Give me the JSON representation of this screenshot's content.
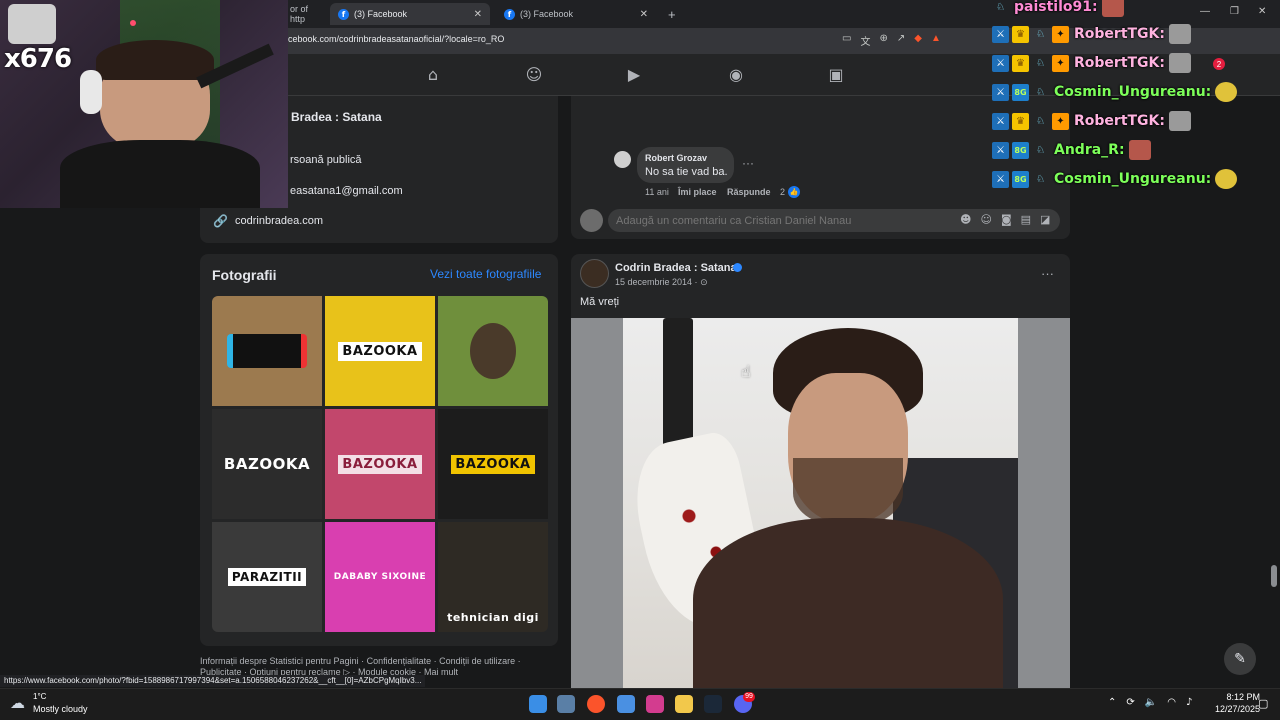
{
  "browser": {
    "tabs": [
      {
        "label": "or of http",
        "active": false
      },
      {
        "label": "(3) Facebook",
        "active": true
      },
      {
        "label": "(3) Facebook",
        "active": false
      }
    ],
    "url": "cebook.com/codrinbradeasatanaoficial/?locale=ro_RO",
    "status_url": "https://www.facebook.com/photo/?fbid=1588986717997394&set=a.1506588046237262&__cft__[0]=AZbCPgMqIbv3..."
  },
  "fb_nav": {
    "icons": [
      "home-icon",
      "friends-icon",
      "video-icon",
      "groups-icon",
      "gaming-icon"
    ],
    "notification_count": "2"
  },
  "intro": {
    "name": "Bradea : Satana",
    "category": "rsoană publică",
    "email": "easatana1@gmail.com",
    "website": "codrinbradea.com"
  },
  "photos": {
    "title": "Fotografii",
    "see_all": "Vezi toate fotografiile",
    "items": [
      {
        "label": "",
        "bg": "#9c7a4f"
      },
      {
        "label": "BAZOOKA",
        "bg": "#e8c21a"
      },
      {
        "label": "",
        "bg": "#6f8f3c"
      },
      {
        "label": "BAZOOKA",
        "bg": "#2c2c2c"
      },
      {
        "label": "BAZOOKA",
        "bg": "#c2476c"
      },
      {
        "label": "BAZOOKA",
        "bg": "#1c1c1c"
      },
      {
        "label": "PARAZITII",
        "bg": "#3a3a3a"
      },
      {
        "label": "DABABY SIXOINE",
        "bg": "#d93fb0"
      },
      {
        "label": "tehnician digi",
        "bg": "#2e2a24"
      }
    ]
  },
  "footer": {
    "line1": "Informații despre Statistici pentru Pagini · Confidențialitate · Condiții de utilizare ·",
    "line2": "Publicitate · Opțiuni pentru reclame ▷ · Module cookie · Mai mult"
  },
  "comment": {
    "author": "Robert Grozav",
    "text": "No sa tie vad ba.",
    "time": "11 ani",
    "like_action": "Îmi place",
    "reply_action": "Răspunde",
    "like_count": "2",
    "input_placeholder": "Adaugă un comentariu ca Cristian Daniel Nanau"
  },
  "post": {
    "author": "Codrin Bradea : Satana",
    "date": "15 decembrie 2014 · ",
    "text": "Mă vreți"
  },
  "stream": {
    "counter": "x676",
    "chat": [
      {
        "user": "paistilo91:",
        "color": "#ff8bd4"
      },
      {
        "user": "RobertTGK:",
        "color": "#ffb3e0"
      },
      {
        "user": "RobertTGK:",
        "color": "#ffb3e0"
      },
      {
        "user": "Cosmin_Ungureanu:",
        "color": "#7dff5a"
      },
      {
        "user": "RobertTGK:",
        "color": "#ffb3e0"
      },
      {
        "user": "Andra_R:",
        "color": "#7dff5a"
      },
      {
        "user": "Cosmin_Ungureanu:",
        "color": "#7dff5a"
      }
    ]
  },
  "taskbar": {
    "temperature": "1°C",
    "weather": "Mostly cloudy",
    "time": "8:12 PM",
    "date": "12/27/2025",
    "notif_badge": "99"
  },
  "colors": {
    "fb_blue": "#1877f2",
    "link_blue": "#2d88ff",
    "card_bg": "#242526",
    "page_bg": "#18191a"
  }
}
